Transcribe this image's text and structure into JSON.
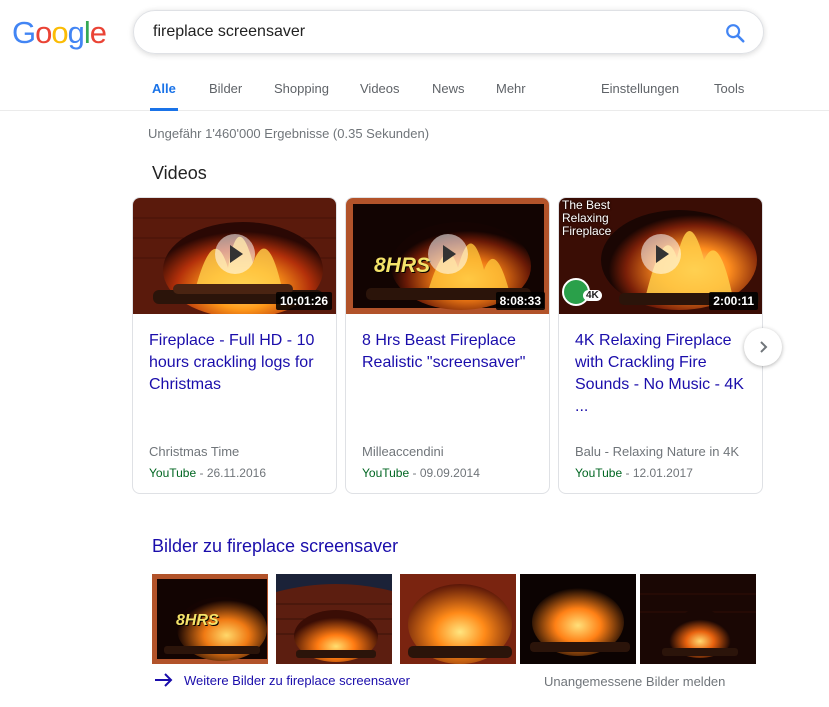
{
  "header": {
    "logo_letters": [
      {
        "char": "G",
        "color": "#4285F4"
      },
      {
        "char": "o",
        "color": "#EA4335"
      },
      {
        "char": "o",
        "color": "#FBBC05"
      },
      {
        "char": "g",
        "color": "#4285F4"
      },
      {
        "char": "l",
        "color": "#34A853"
      },
      {
        "char": "e",
        "color": "#EA4335"
      }
    ],
    "search_value": "fireplace screensaver",
    "search_icon": "search-icon"
  },
  "tabs": {
    "alle": "Alle",
    "bilder": "Bilder",
    "shopping": "Shopping",
    "videos": "Videos",
    "news": "News",
    "mehr": "Mehr",
    "einstellungen": "Einstellungen",
    "tools": "Tools",
    "active_color": "#1a73e8"
  },
  "stats": "Ungefähr 1'460'000 Ergebnisse (0.35 Sekunden)",
  "videos": {
    "section_title": "Videos",
    "items": [
      {
        "title": "Fireplace - Full HD - 10 hours crackling logs for Christmas",
        "duration": "10:01:26",
        "channel": "Christmas Time",
        "platform": "YouTube",
        "date": " - 26.11.2016"
      },
      {
        "title": "8 Hrs Beast Fireplace Realistic \"screensaver\"",
        "duration": "8:08:33",
        "thumb_text": "8HRS",
        "channel": "Milleaccendini",
        "platform": "YouTube",
        "date": " - 09.09.2014"
      },
      {
        "title": "4K Relaxing Fireplace with Crackling Fire Sounds - No Music - 4K ...",
        "duration": "2:00:11",
        "thumb_text": "The Best Relaxing Fireplace",
        "badge": "4K",
        "channel": "Balu - Relaxing Nature in 4K",
        "platform": "YouTube",
        "date": " - 12.01.2017"
      }
    ],
    "next_icon": "chevron-right-icon"
  },
  "images": {
    "section_title": "Bilder zu fireplace screensaver",
    "tile1_text": "8HRS",
    "more_link": "Weitere Bilder zu fireplace screensaver",
    "report_link": "Unangemessene Bilder melden"
  }
}
